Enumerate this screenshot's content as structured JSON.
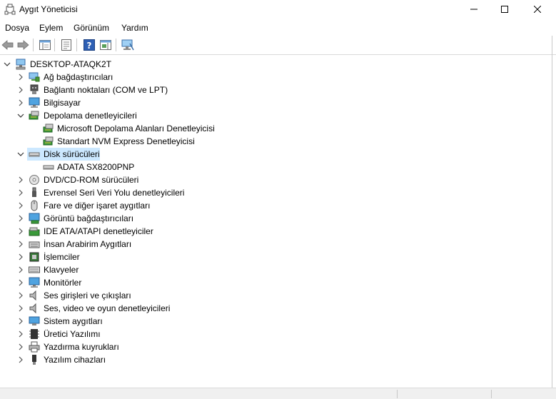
{
  "window": {
    "title": "Aygıt Yöneticisi"
  },
  "menu": [
    "Dosya",
    "Eylem",
    "Görünüm",
    "Yardım"
  ],
  "tree": {
    "root": "DESKTOP-ATAQK2T",
    "nodes": [
      {
        "label": "Ağ bağdaştırıcıları",
        "icon": "network-adapter-icon",
        "expanded": false
      },
      {
        "label": "Bağlantı noktaları (COM ve LPT)",
        "icon": "port-icon",
        "expanded": false
      },
      {
        "label": "Bilgisayar",
        "icon": "computer-icon",
        "expanded": false
      },
      {
        "label": "Depolama denetleyicileri",
        "icon": "storage-controller-icon",
        "expanded": true,
        "children": [
          "Microsoft Depolama Alanları Denetleyicisi",
          "Standart NVM Express Denetleyicisi"
        ]
      },
      {
        "label": "Disk sürücüleri",
        "icon": "disk-drive-icon",
        "expanded": true,
        "selected": true,
        "children": [
          "ADATA SX8200PNP"
        ]
      },
      {
        "label": "DVD/CD-ROM sürücüleri",
        "icon": "dvd-icon",
        "expanded": false
      },
      {
        "label": "Evrensel Seri Veri Yolu denetleyicileri",
        "icon": "usb-icon",
        "expanded": false
      },
      {
        "label": "Fare ve diğer işaret aygıtları",
        "icon": "mouse-icon",
        "expanded": false
      },
      {
        "label": "Görüntü bağdaştırıcıları",
        "icon": "display-adapter-icon",
        "expanded": false
      },
      {
        "label": "IDE ATA/ATAPI denetleyiciler",
        "icon": "ide-icon",
        "expanded": false
      },
      {
        "label": "İnsan Arabirim Aygıtları",
        "icon": "hid-icon",
        "expanded": false
      },
      {
        "label": "İşlemciler",
        "icon": "processor-icon",
        "expanded": false
      },
      {
        "label": "Klavyeler",
        "icon": "keyboard-icon",
        "expanded": false
      },
      {
        "label": "Monitörler",
        "icon": "monitor-icon",
        "expanded": false
      },
      {
        "label": "Ses girişleri ve çıkışları",
        "icon": "speaker-icon",
        "expanded": false
      },
      {
        "label": "Ses, video ve oyun denetleyicileri",
        "icon": "sound-icon",
        "expanded": false
      },
      {
        "label": "Sistem aygıtları",
        "icon": "system-device-icon",
        "expanded": false
      },
      {
        "label": "Üretici Yazılımı",
        "icon": "firmware-icon",
        "expanded": false
      },
      {
        "label": "Yazdırma kuyrukları",
        "icon": "printer-icon",
        "expanded": false
      },
      {
        "label": "Yazılım cihazları",
        "icon": "software-device-icon",
        "expanded": false
      }
    ]
  },
  "colors": {
    "selection": "#cce8ff",
    "accent": "#1e6fd0"
  }
}
